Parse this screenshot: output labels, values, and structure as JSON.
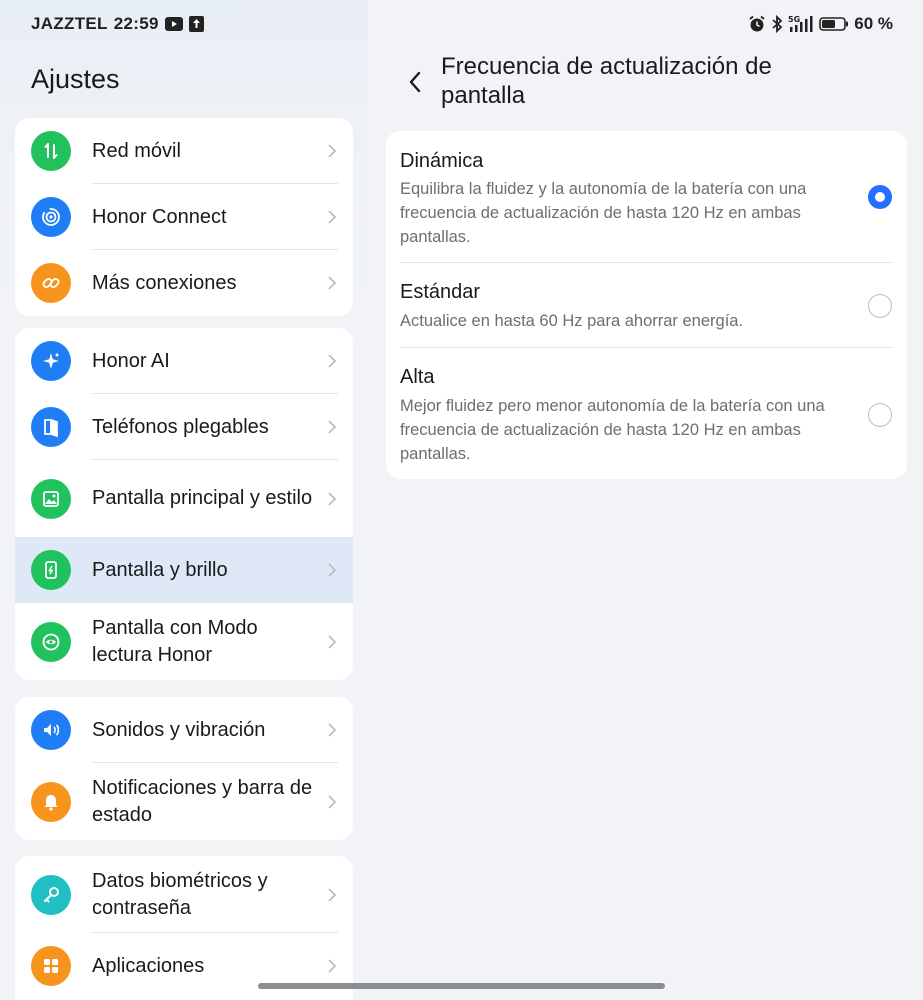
{
  "status_bar": {
    "carrier": "JAZZTEL",
    "time": "22:59",
    "left_icons": [
      "youtube-icon",
      "upload-icon"
    ],
    "right_icons": [
      "alarm-icon",
      "bluetooth-icon",
      "signal-5g-icon",
      "battery-icon"
    ],
    "network": "5G",
    "battery": "60 %"
  },
  "left": {
    "title": "Ajustes",
    "groups": [
      {
        "items": [
          {
            "label": "Red móvil",
            "icon": "mobile-network-icon",
            "color": "#21c25e"
          },
          {
            "label": "Honor Connect",
            "icon": "honor-connect-icon",
            "color": "#1f7ef5"
          },
          {
            "label": "Más conexiones",
            "icon": "link-icon",
            "color": "#f7941d"
          }
        ]
      },
      {
        "items": [
          {
            "label": "Honor AI",
            "icon": "ai-sparkle-icon",
            "color": "#1f7ef5"
          },
          {
            "label": "Teléfonos plegables",
            "icon": "foldable-icon",
            "color": "#1f7ef5"
          },
          {
            "label": "Pantalla principal y estilo",
            "icon": "image-icon",
            "color": "#21c25e"
          },
          {
            "label": "Pantalla y brillo",
            "icon": "display-brightness-icon",
            "color": "#21c25e",
            "selected": true
          },
          {
            "label": "Pantalla con Modo lectura Honor",
            "icon": "eye-comfort-icon",
            "color": "#21c25e"
          }
        ]
      },
      {
        "items": [
          {
            "label": "Sonidos y vibración",
            "icon": "speaker-icon",
            "color": "#1f7ef5"
          },
          {
            "label": "Notificaciones y barra de estado",
            "icon": "bell-icon",
            "color": "#f7941d"
          }
        ]
      },
      {
        "items": [
          {
            "label": "Datos biométricos y contraseña",
            "icon": "key-icon",
            "color": "#1fbfc4"
          },
          {
            "label": "Aplicaciones",
            "icon": "apps-grid-icon",
            "color": "#f7941d"
          }
        ]
      }
    ]
  },
  "right": {
    "title": "Frecuencia de actualización de pantalla",
    "options": [
      {
        "title": "Dinámica",
        "description": "Equilibra la fluidez y la autonomía de la batería con una frecuencia de actualización de hasta 120 Hz en ambas pantallas.",
        "selected": true
      },
      {
        "title": "Estándar",
        "description": "Actualice en hasta 60 Hz para ahorrar energía.",
        "selected": false
      },
      {
        "title": "Alta",
        "description": "Mejor fluidez pero menor autonomía de la batería con una frecuencia de actualización de hasta 120 Hz en ambas pantallas.",
        "selected": false
      }
    ],
    "accent_color": "#256fff"
  }
}
